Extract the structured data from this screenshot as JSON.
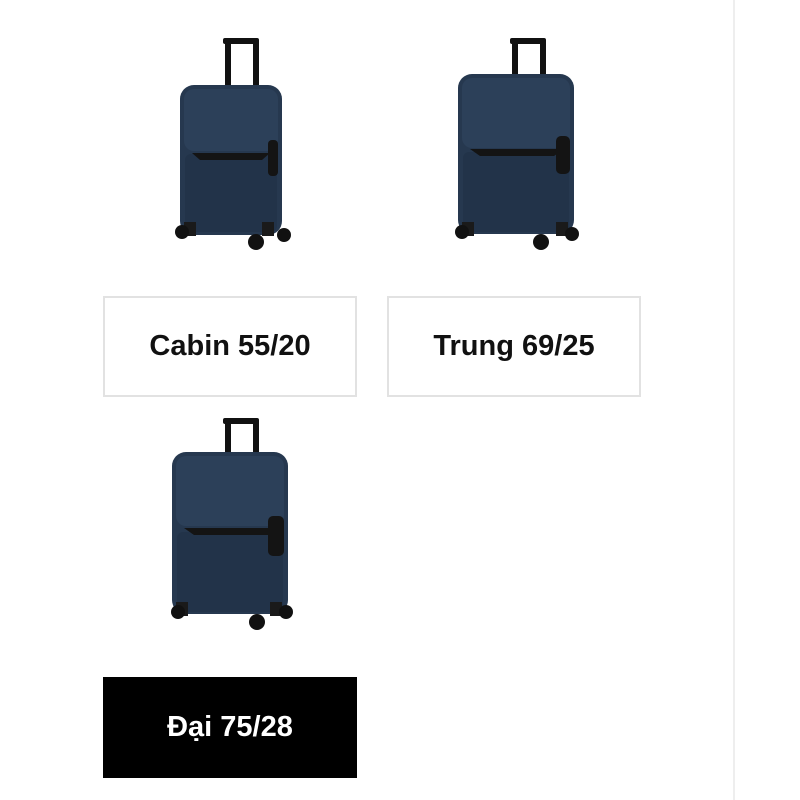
{
  "colors": {
    "shell": "#26384f",
    "shell_dark": "#1c2b3d",
    "handle": "#111111",
    "selected_bg": "#000000",
    "option_border": "#e2e2e2"
  },
  "size_options": [
    {
      "label": "Cabin 55/20",
      "selected": false
    },
    {
      "label": "Trung 69/25",
      "selected": false
    },
    {
      "label": "Đại 75/28",
      "selected": true
    }
  ]
}
